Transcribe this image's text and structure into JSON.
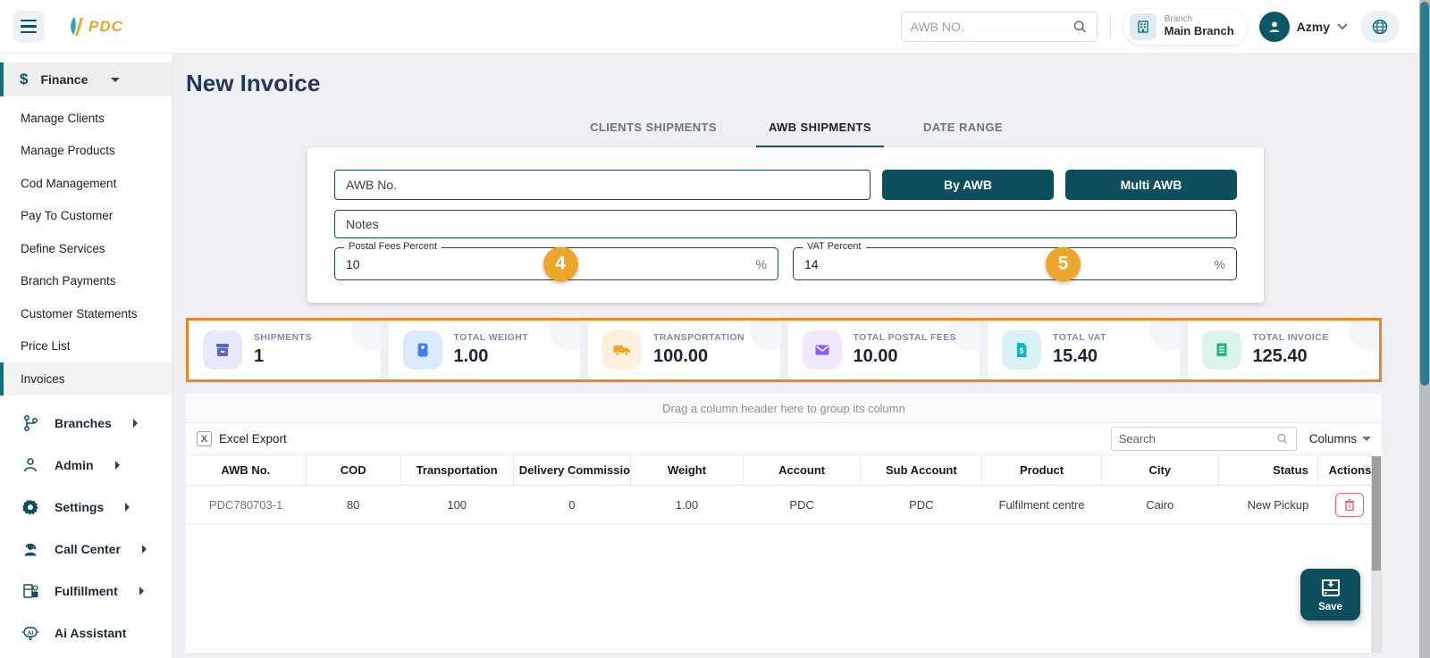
{
  "colors": {
    "accent_teal": "#0d4f5e",
    "accent_orange": "#f6821f",
    "badge_orange": "#eda52c",
    "delete_pink": "#f2597a"
  },
  "header": {
    "logo_text": "PDC",
    "search_placeholder": "AWB NO.",
    "branch_label": "Branch",
    "branch_name": "Main Branch",
    "user_name": "Azmy"
  },
  "sidebar": {
    "finance_label": "Finance",
    "finance_items": [
      {
        "label": "Manage Clients"
      },
      {
        "label": "Manage Products"
      },
      {
        "label": "Cod Management"
      },
      {
        "label": "Pay To Customer"
      },
      {
        "label": "Define Services"
      },
      {
        "label": "Branch Payments"
      },
      {
        "label": "Customer Statements"
      },
      {
        "label": "Price List"
      },
      {
        "label": "Invoices",
        "active": true
      }
    ],
    "groups": [
      {
        "label": "Branches"
      },
      {
        "label": "Admin"
      },
      {
        "label": "Settings"
      },
      {
        "label": "Call Center"
      },
      {
        "label": "Fulfillment"
      },
      {
        "label": "Ai Assistant"
      }
    ]
  },
  "page": {
    "title": "New Invoice",
    "tabs": [
      {
        "label": "CLIENTS SHIPMENTS"
      },
      {
        "label": "AWB SHIPMENTS",
        "active": true
      },
      {
        "label": "DATE RANGE"
      }
    ]
  },
  "form": {
    "awb_placeholder": "AWB No.",
    "by_awb_label": "By AWB",
    "multi_awb_label": "Multi AWB",
    "notes_placeholder": "Notes",
    "postal_fees": {
      "label": "Postal Fees Percent",
      "value": "10",
      "suffix": "%",
      "badge": "4"
    },
    "vat": {
      "label": "VAT Percent",
      "value": "14",
      "suffix": "%",
      "badge": "5"
    }
  },
  "stats": [
    {
      "label": "SHIPMENTS",
      "value": "1",
      "icon": "shipments-box-icon",
      "color": "#5c6bc0"
    },
    {
      "label": "TOTAL WEIGHT",
      "value": "1.00",
      "icon": "weight-icon",
      "color": "#3b82f6"
    },
    {
      "label": "TRANSPORTATION",
      "value": "100.00",
      "icon": "truck-icon",
      "color": "#f5a623"
    },
    {
      "label": "TOTAL POSTAL FEES",
      "value": "10.00",
      "icon": "envelope-icon",
      "color": "#8b5cf6"
    },
    {
      "label": "TOTAL VAT",
      "value": "15.40",
      "icon": "vat-document-icon",
      "color": "#11b3cc"
    },
    {
      "label": "TOTAL INVOICE",
      "value": "125.40",
      "icon": "invoice-receipt-icon",
      "color": "#17b67e"
    }
  ],
  "table": {
    "group_hint": "Drag a column header here to group its column",
    "excel_export_label": "Excel Export",
    "search_placeholder": "Search",
    "columns_label": "Columns",
    "headers": [
      "AWB No.",
      "COD",
      "Transportation",
      "Delivery Commission",
      "Weight",
      "Account",
      "Sub Account",
      "Product",
      "City",
      "Status",
      "Actions"
    ],
    "rows": [
      {
        "awb": "PDC780703-1",
        "cod": "80",
        "transportation": "100",
        "delivery_commission": "0",
        "weight": "1.00",
        "account": "PDC",
        "sub_account": "PDC",
        "product": "Fulfilment centre",
        "city": "Cairo",
        "status": "New Pickup"
      }
    ]
  },
  "save_label": "Save"
}
